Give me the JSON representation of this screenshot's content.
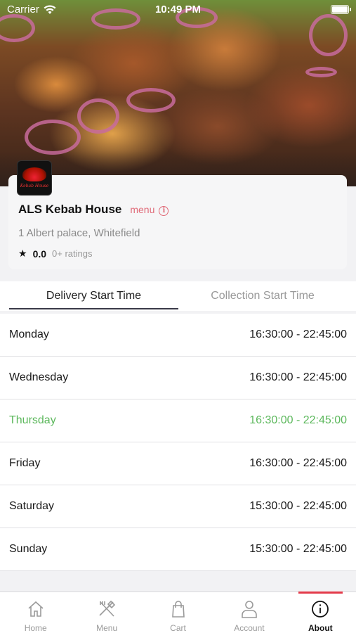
{
  "status_bar": {
    "carrier": "Carrier",
    "time": "10:49 PM"
  },
  "restaurant": {
    "name": "ALS Kebab House",
    "menu_link": "menu",
    "address": "1 Albert palace, Whitefield",
    "rating": "0.0",
    "ratings_count": "0+ ratings",
    "logo_text": "Kebab House"
  },
  "tabs": {
    "delivery": "Delivery Start Time",
    "collection": "Collection Start Time",
    "active": "delivery"
  },
  "hours": [
    {
      "day": "Monday",
      "time": "16:30:00 - 22:45:00",
      "highlight": false
    },
    {
      "day": "Wednesday",
      "time": "16:30:00 - 22:45:00",
      "highlight": false
    },
    {
      "day": "Thursday",
      "time": "16:30:00 - 22:45:00",
      "highlight": true
    },
    {
      "day": "Friday",
      "time": "16:30:00 - 22:45:00",
      "highlight": false
    },
    {
      "day": "Saturday",
      "time": "15:30:00 - 22:45:00",
      "highlight": false
    },
    {
      "day": "Sunday",
      "time": "15:30:00 - 22:45:00",
      "highlight": false
    }
  ],
  "tabbar": {
    "items": [
      {
        "label": "Home",
        "icon": "home-icon"
      },
      {
        "label": "Menu",
        "icon": "fork-knife-icon"
      },
      {
        "label": "Cart",
        "icon": "shopping-bag-icon"
      },
      {
        "label": "Account",
        "icon": "person-icon"
      },
      {
        "label": "About",
        "icon": "info-icon"
      }
    ],
    "active": "About"
  },
  "colors": {
    "accent": "#e33a4a",
    "menu_link": "#e06a78",
    "today_highlight": "#5cb85c"
  }
}
